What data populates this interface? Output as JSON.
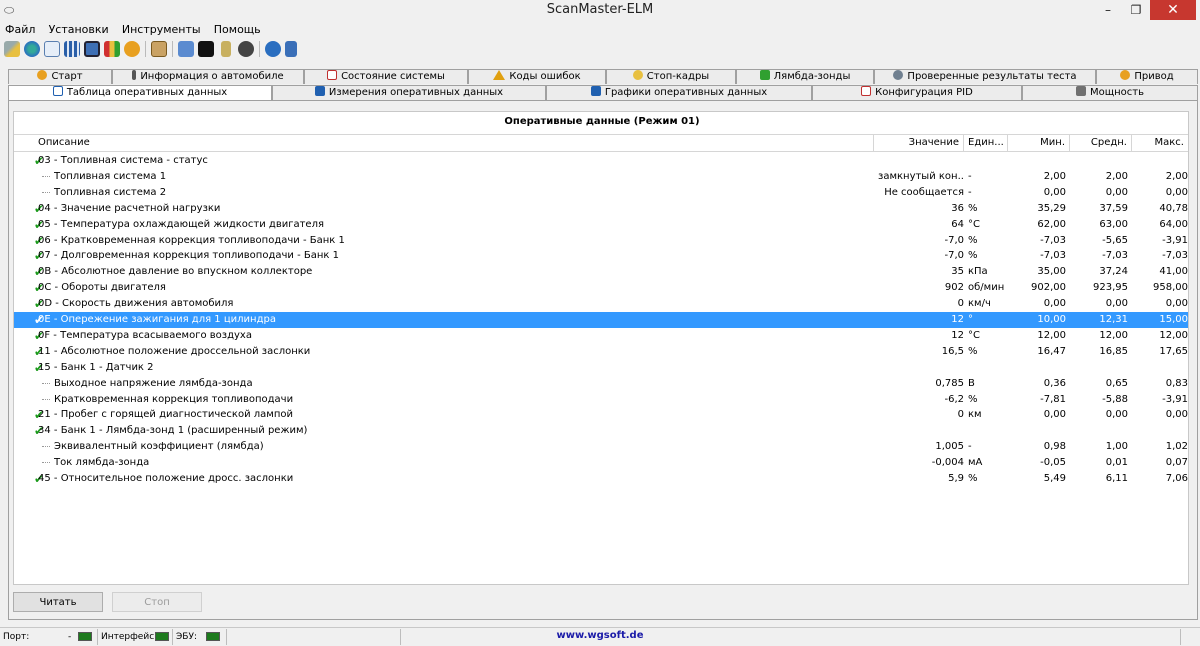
{
  "window": {
    "title": "ScanMaster-ELM",
    "minimize": "–",
    "restore": "❐",
    "close": "✕"
  },
  "menu": [
    "Файл",
    "Установки",
    "Инструменты",
    "Помощь"
  ],
  "toolbar_icons": [
    "wrench-icon",
    "globe-icon",
    "document-icon",
    "grid-icon",
    "monitor-icon",
    "chart-icon",
    "dollar-icon",
    "clipboard-icon",
    "chat-icon",
    "terminal-icon",
    "battery-icon",
    "stop-icon",
    "info-icon",
    "exit-icon"
  ],
  "tabs_row1": [
    {
      "label": "Старт",
      "icon_color": "#e8a020"
    },
    {
      "label": "Информация о автомобиле",
      "icon_color": "#555555"
    },
    {
      "label": "Состояние системы",
      "icon_color": "#c03030"
    },
    {
      "label": "Коды ошибок",
      "icon_color": "#e0a010"
    },
    {
      "label": "Стоп-кадры",
      "icon_color": "#e8c040"
    },
    {
      "label": "Лямбда-зонды",
      "icon_color": "#30a030"
    },
    {
      "label": "Проверенные результаты теста",
      "icon_color": "#708090"
    },
    {
      "label": "Привод",
      "icon_color": "#e8a020"
    }
  ],
  "tabs_row2": [
    {
      "label": "Таблица оперативных данных",
      "icon_color": "#2060b0"
    },
    {
      "label": "Измерения оперативных данных",
      "icon_color": "#2060b0"
    },
    {
      "label": "Графики оперативных данных",
      "icon_color": "#2060b0"
    },
    {
      "label": "Конфигурация PID",
      "icon_color": "#c03030"
    },
    {
      "label": "Мощность",
      "icon_color": "#707070"
    }
  ],
  "grid": {
    "title": "Оперативные данные (Режим 01)",
    "columns": {
      "desc": "Описание",
      "value": "Значение",
      "unit": "Един...",
      "min": "Мин.",
      "avg": "Средн.",
      "max": "Макс."
    },
    "rows": [
      {
        "desc": "03 - Топливная система - статус",
        "value": "",
        "unit": "",
        "min": "",
        "avg": "",
        "max": "",
        "check": true,
        "child": false,
        "selected": false
      },
      {
        "desc": "Топливная система 1",
        "value": "замкнутый кон...",
        "unit": "-",
        "min": "2,00",
        "avg": "2,00",
        "max": "2,00",
        "check": false,
        "child": true,
        "selected": false
      },
      {
        "desc": "Топливная система 2",
        "value": "Не сообщается",
        "unit": "-",
        "min": "0,00",
        "avg": "0,00",
        "max": "0,00",
        "check": false,
        "child": true,
        "selected": false
      },
      {
        "desc": "04 - Значение расчетной нагрузки",
        "value": "36",
        "unit": "%",
        "min": "35,29",
        "avg": "37,59",
        "max": "40,78",
        "check": true,
        "child": false,
        "selected": false
      },
      {
        "desc": "05 - Температура охлаждающей жидкости двигателя",
        "value": "64",
        "unit": "°C",
        "min": "62,00",
        "avg": "63,00",
        "max": "64,00",
        "check": true,
        "child": false,
        "selected": false
      },
      {
        "desc": "06 - Кратковременная коррекция топливоподачи - Банк 1",
        "value": "-7,0",
        "unit": "%",
        "min": "-7,03",
        "avg": "-5,65",
        "max": "-3,91",
        "check": true,
        "child": false,
        "selected": false
      },
      {
        "desc": "07 - Долговременная коррекция топливоподачи - Банк 1",
        "value": "-7,0",
        "unit": "%",
        "min": "-7,03",
        "avg": "-7,03",
        "max": "-7,03",
        "check": true,
        "child": false,
        "selected": false
      },
      {
        "desc": "0B - Абсолютное давление во впускном коллекторе",
        "value": "35",
        "unit": "кПа",
        "min": "35,00",
        "avg": "37,24",
        "max": "41,00",
        "check": true,
        "child": false,
        "selected": false
      },
      {
        "desc": "0C - Обороты двигателя",
        "value": "902",
        "unit": "об/мин",
        "min": "902,00",
        "avg": "923,95",
        "max": "958,00",
        "check": true,
        "child": false,
        "selected": false
      },
      {
        "desc": "0D - Скорость движения автомобиля",
        "value": "0",
        "unit": "км/ч",
        "min": "0,00",
        "avg": "0,00",
        "max": "0,00",
        "check": true,
        "child": false,
        "selected": false
      },
      {
        "desc": "0E - Опережение зажигания для 1 цилиндра",
        "value": "12",
        "unit": "°",
        "min": "10,00",
        "avg": "12,31",
        "max": "15,00",
        "check": true,
        "child": false,
        "selected": true
      },
      {
        "desc": "0F - Температура всасываемого воздуха",
        "value": "12",
        "unit": "°C",
        "min": "12,00",
        "avg": "12,00",
        "max": "12,00",
        "check": true,
        "child": false,
        "selected": false
      },
      {
        "desc": "11 - Абсолютное положение дроссельной заслонки",
        "value": "16,5",
        "unit": "%",
        "min": "16,47",
        "avg": "16,85",
        "max": "17,65",
        "check": true,
        "child": false,
        "selected": false
      },
      {
        "desc": "15 - Банк 1 - Датчик 2",
        "value": "",
        "unit": "",
        "min": "",
        "avg": "",
        "max": "",
        "check": true,
        "child": false,
        "selected": false
      },
      {
        "desc": "Выходное напряжение лямбда-зонда",
        "value": "0,785",
        "unit": "В",
        "min": "0,36",
        "avg": "0,65",
        "max": "0,83",
        "check": false,
        "child": true,
        "selected": false
      },
      {
        "desc": "Кратковременная коррекция топливоподачи",
        "value": "-6,2",
        "unit": "%",
        "min": "-7,81",
        "avg": "-5,88",
        "max": "-3,91",
        "check": false,
        "child": true,
        "selected": false
      },
      {
        "desc": "21 - Пробег с горящей диагностической лампой",
        "value": "0",
        "unit": "км",
        "min": "0,00",
        "avg": "0,00",
        "max": "0,00",
        "check": true,
        "child": false,
        "selected": false
      },
      {
        "desc": "34 - Банк 1 - Лямбда-зонд 1 (расширенный режим)",
        "value": "",
        "unit": "",
        "min": "",
        "avg": "",
        "max": "",
        "check": true,
        "child": false,
        "selected": false
      },
      {
        "desc": "Эквивалентный коэффициент (лямбда)",
        "value": "1,005",
        "unit": "-",
        "min": "0,98",
        "avg": "1,00",
        "max": "1,02",
        "check": false,
        "child": true,
        "selected": false
      },
      {
        "desc": "Ток лямбда-зонда",
        "value": "-0,004",
        "unit": "мА",
        "min": "-0,05",
        "avg": "0,01",
        "max": "0,07",
        "check": false,
        "child": true,
        "selected": false
      },
      {
        "desc": "45 - Относительное положение дросс. заслонки",
        "value": "5,9",
        "unit": "%",
        "min": "5,49",
        "avg": "6,11",
        "max": "7,06",
        "check": true,
        "child": false,
        "selected": false
      }
    ]
  },
  "buttons": {
    "read": "Читать",
    "stop": "Стоп"
  },
  "status": {
    "port_label": "Порт:",
    "port_value": "-",
    "interface_label": "Интерфейс:",
    "ecu_label": "ЭБУ:",
    "website": "www.wgsoft.de",
    "led_color": "#1d7a1d"
  }
}
